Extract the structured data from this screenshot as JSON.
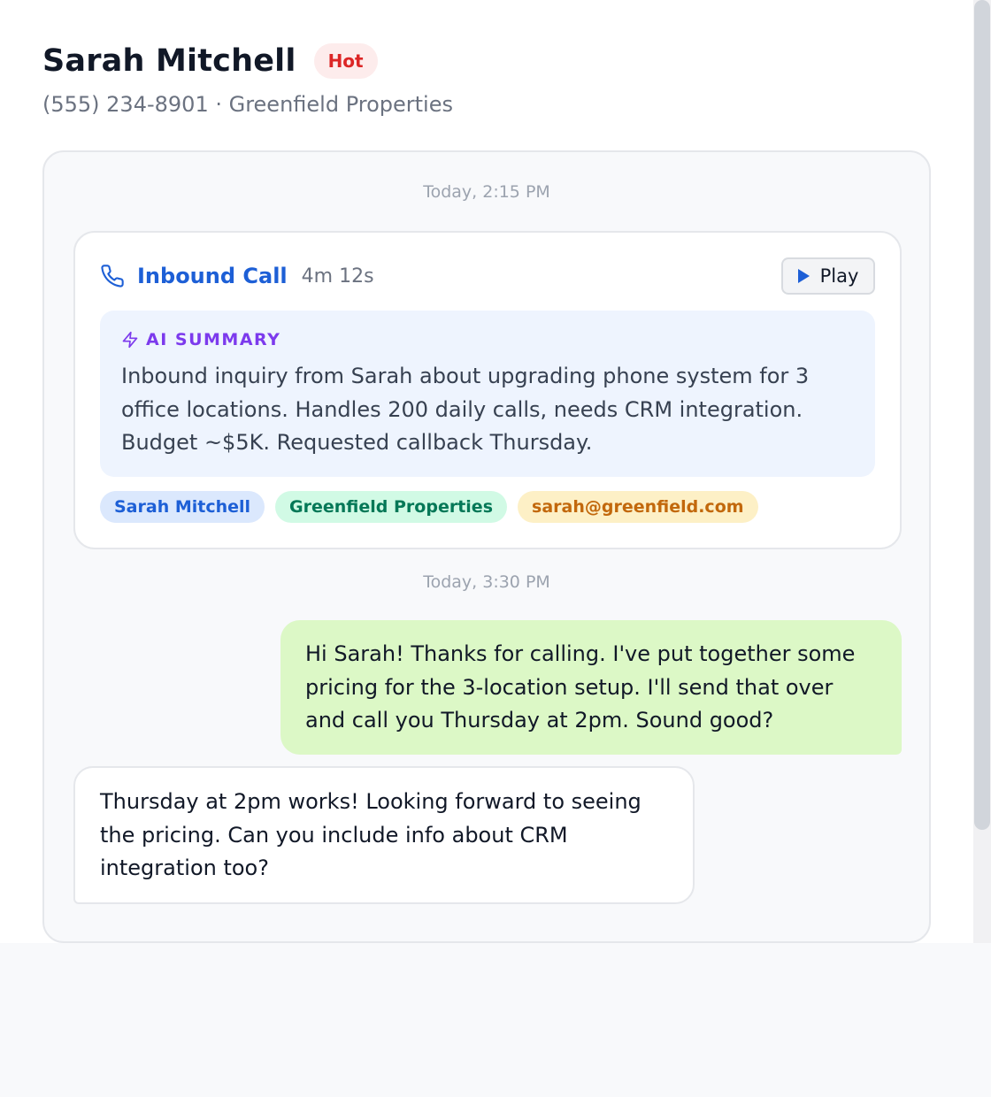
{
  "contact": {
    "name": "Sarah Mitchell",
    "status": "Hot",
    "subtitle": "(555) 234-8901 · Greenfield Properties"
  },
  "thread": {
    "call": {
      "timestamp": "Today, 2:15 PM",
      "icon": "phone-icon",
      "title": "Inbound Call",
      "duration": "4m 12s",
      "play_label": "Play",
      "summary": {
        "icon": "bolt-icon",
        "label": "AI SUMMARY",
        "text": "Inbound inquiry from Sarah about upgrading phone system for 3 office locations. Handles 200 daily calls, needs CRM integration. Budget ~$5K. Requested callback Thursday."
      },
      "tags": [
        "Sarah Mitchell",
        "Greenfield Properties",
        "sarah@greenfield.com"
      ]
    },
    "messages_timestamp": "Today, 3:30 PM",
    "messages": [
      {
        "direction": "outbound",
        "text": "Hi Sarah! Thanks for calling. I've put together some pricing for the 3-location setup. I'll send that over and call you Thursday at 2pm. Sound good?"
      },
      {
        "direction": "inbound",
        "text": "Thursday at 2pm works! Looking forward to seeing the pricing. Can you include info about CRM integration too?"
      }
    ]
  },
  "colors": {
    "accent": "#1d5fd6",
    "hot": "#dc2626",
    "ai": "#7c3aed",
    "outbound_bubble": "#dcf8c6"
  }
}
